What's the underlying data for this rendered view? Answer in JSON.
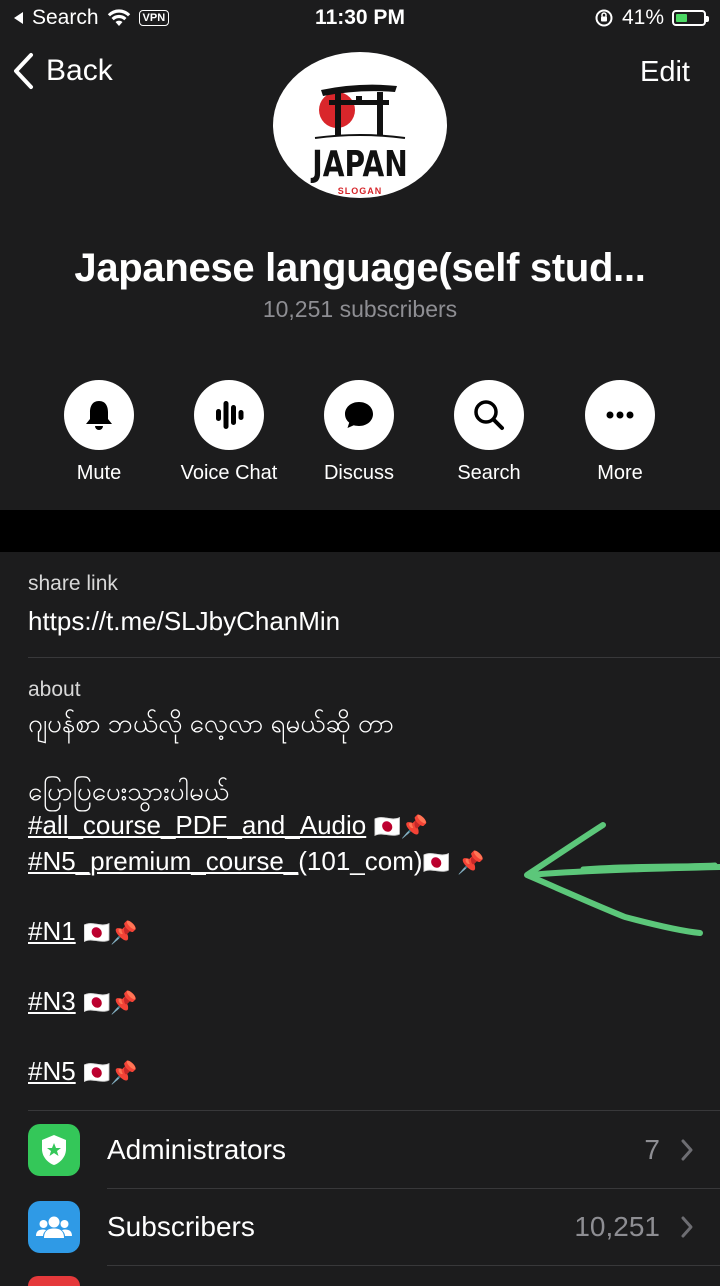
{
  "status_bar": {
    "carrier": "Search",
    "vpn": "VPN",
    "time": "11:30 PM",
    "battery": "41%",
    "battery_level": 0.41,
    "battery_color": "#4cd964"
  },
  "nav": {
    "back_label": "Back",
    "edit_label": "Edit"
  },
  "channel": {
    "logo_text": "JAPAN",
    "logo_sub": "SLOGAN",
    "title": "Japanese language(self stud...",
    "subscribers": "10,251 subscribers"
  },
  "actions": [
    {
      "label": "Mute",
      "icon": "bell-icon"
    },
    {
      "label": "Voice Chat",
      "icon": "voice-wave-icon"
    },
    {
      "label": "Discuss",
      "icon": "chat-bubble-icon"
    },
    {
      "label": "Search",
      "icon": "search-icon"
    },
    {
      "label": "More",
      "icon": "ellipsis-icon"
    }
  ],
  "info": {
    "share_link_label": "share link",
    "share_link": "https://t.me/SLJbyChanMin",
    "about_label": "about",
    "about_line1": "ဂျပန်စာ ဘယ်လို လေ့လာ ရမယ်ဆို တာ",
    "about_line2": "ပြောပြပေးသွားပါမယ်",
    "tag1": "#all_course_PDF_and_Audio",
    "tag2": "#N5_premium_course_",
    "tag2_rest": "(101_com)",
    "tag3": "#N1",
    "tag4": "#N3",
    "tag5": "#N5",
    "flag": "🇯🇵",
    "pin": "📌"
  },
  "rows": [
    {
      "name": "Administrators",
      "value": "7",
      "icon": "admin-shield-icon",
      "color": "#34c759"
    },
    {
      "name": "Subscribers",
      "value": "10,251",
      "icon": "people-icon",
      "color": "#2f9ae6"
    }
  ],
  "colors": {
    "annotation_arrow": "#5cc77a"
  }
}
